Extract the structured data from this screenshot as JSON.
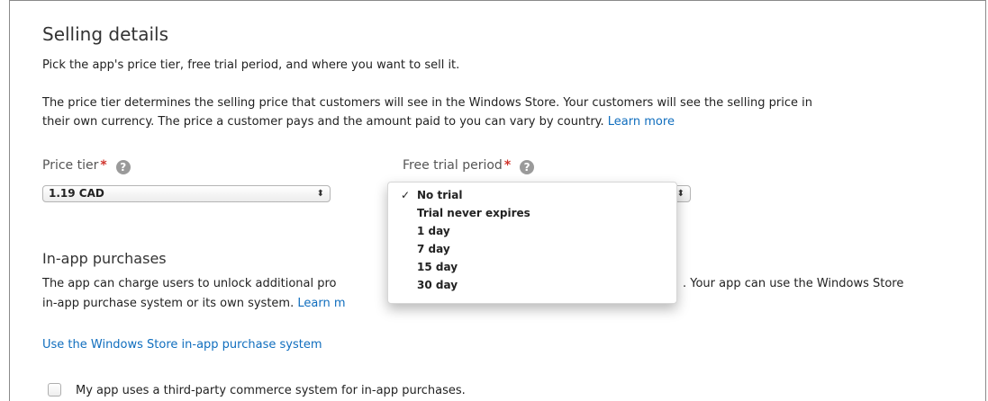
{
  "selling": {
    "title": "Selling details",
    "intro": "Pick the app's price tier, free trial period, and where you want to sell it.",
    "desc_line1": "The price tier determines the selling price that customers will see in the Windows Store. Your customers will see the selling price in",
    "desc_line2": "their own currency. The price a customer pays and the amount paid to you can vary by country.",
    "learn_more": "Learn more"
  },
  "price_tier": {
    "label": "Price tier",
    "required_mark": "*",
    "help_icon": "?",
    "value": "1.19 CAD"
  },
  "free_trial": {
    "label": "Free trial period",
    "required_mark": "*",
    "help_icon": "?",
    "options": [
      {
        "label": "No trial",
        "checked": true
      },
      {
        "label": "Trial never expires",
        "checked": false
      },
      {
        "label": "1 day",
        "checked": false
      },
      {
        "label": "7 day",
        "checked": false
      },
      {
        "label": "15 day",
        "checked": false
      },
      {
        "label": "30 day",
        "checked": false
      }
    ],
    "check_glyph": "✓"
  },
  "in_app": {
    "title": "In-app purchases",
    "desc_line1_start": "The app can charge users to unlock additional pro",
    "desc_line1_end": ". Your app can use the Windows Store",
    "desc_line2_start": "in-app purchase system or its own system.",
    "learn_more_partial": "Learn m",
    "link_text": "Use the Windows Store in-app purchase system",
    "checkbox_label": "My app uses a third-party commerce system for in-app purchases."
  },
  "colors": {
    "link": "#106ebe",
    "required": "#d0342c"
  }
}
